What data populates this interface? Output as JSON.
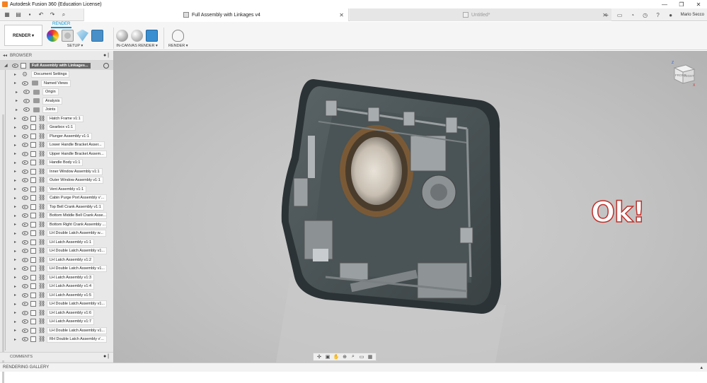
{
  "window": {
    "title": "Autodesk Fusion 360 (Education License)",
    "controls": [
      "—",
      "❐",
      "✕"
    ]
  },
  "tabs": {
    "active_label": "Full Assembly with Linkages v4",
    "inactive_label": "Untitled*",
    "user": "Mario Secco"
  },
  "ribbon": {
    "workspace": "RENDER ▾",
    "tab": "RENDER",
    "groups": {
      "setup": "SETUP ▾",
      "in_canvas": "IN-CANVAS RENDER ▾",
      "render": "RENDER ▾"
    }
  },
  "browser": {
    "header": "BROWSER",
    "root": "Full Assembly with Linkages...",
    "folders": [
      {
        "label": "Document Settings",
        "icon": "gear-icon"
      },
      {
        "label": "Named Views",
        "icon": "folder-icon"
      },
      {
        "label": "Origin",
        "icon": "folder-icon"
      },
      {
        "label": "Analysis",
        "icon": "folder-icon"
      },
      {
        "label": "Joints",
        "icon": "folder-icon"
      }
    ],
    "components": [
      "Hatch Frame v1:1",
      "Gearbox v1:1",
      "Plunger Assembly v1:1",
      "Lower Handle Bracket Asser...",
      "Upper Handle Bracket Assem...",
      "Handle Body v1:1",
      "Inner Window Assembly v1:1",
      "Outer Window Assembly v1:1",
      "Vent Assembly v1:1",
      "Cabin Purge Port Assembly v'...",
      "Top Bell Crank Assembly v1:1",
      "Bottom Middle Bell Crank Asse...",
      "Bottom Right Crank Assembly ...",
      "LH Double Latch Assembly w...",
      "LH Latch Assembly v1:1",
      "LH Double Latch Assembly v1...",
      "LH Latch Assembly v1:2",
      "LH Double Latch Assembly v1...",
      "LH Latch Assembly v1:3",
      "LH Latch Assembly v1:4",
      "LH Latch Assembly v1:5",
      "LH Double Latch Assembly v1...",
      "LH Latch Assembly v1:6",
      "LH Latch Assembly v1:7",
      "LH Double Latch Assembly v1...",
      "RH Double Latch Assembly v'..."
    ]
  },
  "comments": "COMMENTS",
  "gallery": "RENDERING GALLERY",
  "overlay_text": "Ok!",
  "viewcube": {
    "front": "FRONT",
    "right": "RIGHT",
    "z": "Z",
    "x": "X"
  },
  "colors": {
    "accent": "#0696d7",
    "ok_stroke": "#c0302a",
    "app_icon": "#f58220"
  }
}
